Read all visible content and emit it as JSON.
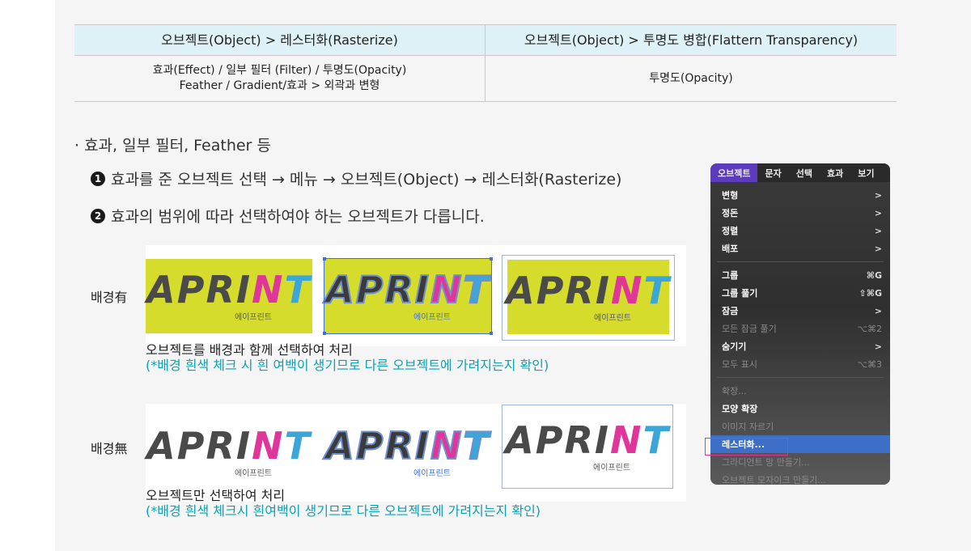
{
  "table": {
    "headers": [
      "오브젝트(Object) > 레스터화(Rasterize)",
      "오브젝트(Object) > 투명도 병합(Flattern Transparency)"
    ],
    "row_left_line1": "효과(Effect) / 일부 필터 (Filter) / 투명도(Opacity)",
    "row_left_line2": "Feather / Gradient/효과 > 외곽과 변형",
    "row_right": "투명도(Opacity)"
  },
  "bullet": "· 효과, 일부 필터, Feather 등",
  "steps": [
    {
      "num": "1",
      "text": "효과를 준 오브젝트 선택 → 메뉴 → 오브젝트(Object) → 레스터화(Rasterize)"
    },
    {
      "num": "2",
      "text": "효과의 범위에 따라 선택하여야 하는 오브젝트가 다릅니다."
    }
  ],
  "logo": {
    "text_a": "APRI",
    "text_p": "N",
    "text_b": "T",
    "sub": "에이프린트"
  },
  "row1": {
    "label": "배경有",
    "caption": "오브젝트를 배경과 함께 선택하여 처리",
    "note": "(*배경 흰색 체크 시 흰 여백이 생기므로 다른 오브젝트에 가려지는지 확인)"
  },
  "row2": {
    "label": "배경無",
    "caption": "오브젝트만 선택하여 처리",
    "note": "(*배경 흰색 체크시 흰여백이 생기므로 다른 오브젝트에 가려지는지 확인)"
  },
  "menu": {
    "bar": [
      "오브젝트",
      "문자",
      "선택",
      "효과",
      "보기"
    ],
    "items": [
      {
        "label": "변형",
        "right": ">",
        "disabled": false
      },
      {
        "label": "정돈",
        "right": ">",
        "disabled": false
      },
      {
        "label": "정렬",
        "right": ">",
        "disabled": false
      },
      {
        "label": "배포",
        "right": ">",
        "disabled": false
      },
      {
        "label": "그룹",
        "right": "⌘G",
        "disabled": false
      },
      {
        "label": "그룹 풀기",
        "right": "⇧⌘G",
        "disabled": false
      },
      {
        "label": "잠금",
        "right": ">",
        "disabled": false
      },
      {
        "label": "모든 잠금 풀기",
        "right": "⌥⌘2",
        "disabled": true
      },
      {
        "label": "숨기기",
        "right": ">",
        "disabled": false
      },
      {
        "label": "모두 표시",
        "right": "⌥⌘3",
        "disabled": true
      },
      {
        "label": "확장...",
        "right": "",
        "disabled": true
      },
      {
        "label": "모양 확장",
        "right": "",
        "disabled": false
      },
      {
        "label": "이미지 자르기",
        "right": "",
        "disabled": true
      },
      {
        "label": "레스터화...",
        "right": "",
        "disabled": false
      },
      {
        "label": "그라디언트 망 만들기...",
        "right": "",
        "disabled": true
      },
      {
        "label": "오브젝트 모자이크 만들기...",
        "right": "",
        "disabled": true
      }
    ]
  },
  "colors": {
    "accent_teal": "#0aa1b4",
    "highlight_pink": "#e0359b",
    "menu_active": "#5c3bbd",
    "tile_yellow": "#d5dc2b"
  }
}
